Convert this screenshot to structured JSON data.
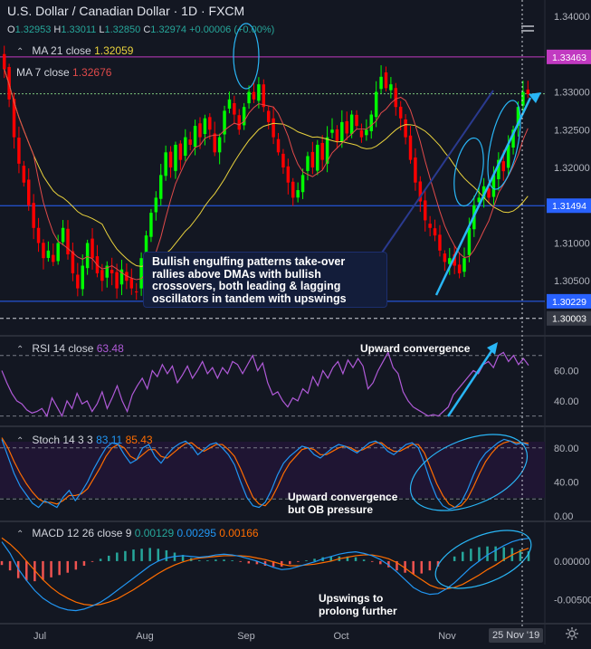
{
  "header": {
    "title": "U.S. Dollar / Canadian Dollar · 1D · FXCM",
    "ohlc": [
      {
        "k": "O",
        "v": "1.32953"
      },
      {
        "k": "H",
        "v": "1.33011"
      },
      {
        "k": "L",
        "v": "1.32850"
      },
      {
        "k": "C",
        "v": "1.32974"
      }
    ],
    "change": "+0.00006 (+0.00%)",
    "ma21_label": "MA 21 close",
    "ma21_value": "1.32059",
    "ma7_label": "MA 7 close",
    "ma7_value": "1.32676"
  },
  "panes": {
    "rsi_label": "RSI 14 close",
    "rsi_value": "63.48",
    "stoch_label": "Stoch 14 3 3",
    "stoch_k": "83.11",
    "stoch_d": "85.43",
    "macd_label": "MACD 12 26 close 9",
    "macd_hist": "0.00129",
    "macd_line": "0.00295",
    "macd_signal": "0.00166"
  },
  "annotations": {
    "callout": "Bullish engulfing patterns take-over rallies above DMAs with bullish crossovers, both leading & lagging oscillators in tandem with upswings",
    "rsi_note": "Upward convergence",
    "stoch_note": "Upward convergence\nbut OB pressure",
    "macd_note": "Upswings to\nprolong further"
  },
  "date_badge": "25 Nov '19",
  "colors": {
    "background": "#131722",
    "bull": "#00ff00",
    "bear": "#ff0000",
    "ma21": "#e9d23d",
    "ma7": "#e04a4a",
    "hline": "#2962ff",
    "resistance": "#c13ac1",
    "trend": "#29b6f6",
    "rsi": "#b05ad8",
    "stoch_k": "#2196f3",
    "stoch_d": "#ff6d00"
  },
  "chart_data": [
    {
      "type": "candlestick",
      "title": "U.S. Dollar / Canadian Dollar · 1D · FXCM",
      "x_ticks": [
        "Jul",
        "Aug",
        "Sep",
        "Oct",
        "Nov"
      ],
      "y_ticks": [
        "1.34000",
        "1.33000",
        "1.32500",
        "1.32000",
        "1.31000",
        "1.30500"
      ],
      "ylim": [
        1.2988,
        1.3412
      ],
      "price_labels": [
        {
          "v": "1.33463",
          "color": "#c13ac1"
        },
        {
          "v": "1.31494",
          "color": "#2962ff"
        },
        {
          "v": "1.30229",
          "color": "#2962ff"
        },
        {
          "v": "1.30003",
          "color": "#363a45"
        }
      ],
      "levels": {
        "resistance": 1.33463,
        "mid": 1.31494,
        "support": 1.30229,
        "current": 1.32974
      },
      "closes": [
        1.333,
        1.329,
        1.324,
        1.3205,
        1.318,
        1.315,
        1.312,
        1.31,
        1.308,
        1.309,
        1.3075,
        1.31,
        1.312,
        1.3085,
        1.306,
        1.304,
        1.307,
        1.31,
        1.308,
        1.306,
        1.305,
        1.307,
        1.306,
        1.304,
        1.3065,
        1.305,
        1.304,
        1.3035,
        1.308,
        1.311,
        1.314,
        1.316,
        1.319,
        1.322,
        1.32,
        1.323,
        1.321,
        1.324,
        1.323,
        1.3255,
        1.324,
        1.3265,
        1.325,
        1.322,
        1.324,
        1.3275,
        1.329,
        1.327,
        1.325,
        1.328,
        1.33,
        1.329,
        1.331,
        1.328,
        1.326,
        1.324,
        1.322,
        1.32,
        1.318,
        1.316,
        1.317,
        1.319,
        1.3215,
        1.32,
        1.323,
        1.321,
        1.324,
        1.325,
        1.3235,
        1.326,
        1.3245,
        1.327,
        1.3255,
        1.324,
        1.325,
        1.327,
        1.33,
        1.332,
        1.3305,
        1.331,
        1.328,
        1.3265,
        1.324,
        1.321,
        1.318,
        1.3155,
        1.313,
        1.312,
        1.311,
        1.309,
        1.3075,
        1.308,
        1.307,
        1.306,
        1.308,
        1.312,
        1.315,
        1.316,
        1.3175,
        1.316,
        1.319,
        1.321,
        1.3195,
        1.323,
        1.325,
        1.328,
        1.33,
        1.3297
      ]
    },
    {
      "type": "line",
      "title": "RSI 14 close",
      "y_ticks": [
        "60.00",
        "40.00"
      ],
      "ylim": [
        25,
        80
      ],
      "series": [
        {
          "name": "RSI 14 close",
          "values": [
            60,
            52,
            45,
            40,
            38,
            34,
            32,
            33,
            35,
            30,
            42,
            36,
            30,
            40,
            35,
            45,
            38,
            40,
            33,
            38,
            46,
            35,
            42,
            50,
            40,
            33,
            44,
            50,
            55,
            48,
            60,
            56,
            64,
            58,
            63,
            52,
            57,
            63,
            55,
            60,
            66,
            58,
            62,
            55,
            62,
            58,
            66,
            64,
            58,
            64,
            70,
            60,
            65,
            52,
            44,
            46,
            40,
            36,
            42,
            40,
            48,
            45,
            56,
            50,
            60,
            55,
            62,
            66,
            58,
            67,
            62,
            68,
            63,
            48,
            52,
            60,
            66,
            72,
            62,
            58,
            46,
            40,
            36,
            34,
            32,
            30,
            31,
            30,
            33,
            36,
            44,
            48,
            52,
            56,
            60,
            58,
            64,
            66,
            62,
            70,
            72,
            66,
            70,
            64,
            68,
            63.5
          ]
        }
      ]
    },
    {
      "type": "line",
      "title": "Stoch 14 3 3",
      "y_ticks": [
        "80.00",
        "40.00",
        "0.00"
      ],
      "ylim": [
        0,
        100
      ],
      "series": [
        {
          "name": "Stoch %K",
          "values": [
            90,
            70,
            50,
            35,
            25,
            15,
            10,
            18,
            14,
            10,
            22,
            30,
            18,
            28,
            40,
            55,
            68,
            80,
            86,
            84,
            72,
            62,
            66,
            80,
            84,
            70,
            62,
            72,
            80,
            85,
            88,
            82,
            72,
            78,
            84,
            86,
            80,
            72,
            60,
            40,
            22,
            12,
            10,
            16,
            30,
            48,
            62,
            70,
            76,
            82,
            80,
            72,
            68,
            74,
            80,
            84,
            82,
            78,
            74,
            80,
            86,
            88,
            84,
            76,
            72,
            78,
            84,
            86,
            80,
            62,
            40,
            22,
            12,
            8,
            10,
            16,
            30,
            48,
            64,
            74,
            80,
            86,
            90,
            88,
            84,
            86,
            83
          ]
        },
        {
          "name": "Stoch %D",
          "values": [
            92,
            80,
            64,
            50,
            38,
            28,
            20,
            16,
            16,
            14,
            18,
            24,
            24,
            26,
            32,
            44,
            56,
            70,
            80,
            84,
            80,
            70,
            66,
            72,
            78,
            78,
            70,
            68,
            74,
            80,
            85,
            86,
            80,
            76,
            80,
            84,
            84,
            78,
            70,
            55,
            38,
            22,
            14,
            12,
            20,
            34,
            50,
            62,
            70,
            78,
            80,
            78,
            72,
            72,
            76,
            80,
            82,
            80,
            76,
            78,
            82,
            86,
            86,
            80,
            76,
            76,
            80,
            84,
            84,
            74,
            56,
            38,
            24,
            14,
            10,
            12,
            20,
            34,
            50,
            64,
            74,
            82,
            86,
            88,
            86,
            86,
            85.4
          ]
        }
      ]
    },
    {
      "type": "line",
      "title": "MACD 12 26 close 9",
      "y_ticks": [
        "0.00000",
        "-0.00500"
      ],
      "ylim": [
        -0.0075,
        0.0035
      ],
      "series": [
        {
          "name": "MACD",
          "values": [
            0.0025,
            0.001,
            -0.001,
            -0.0025,
            -0.0038,
            -0.0048,
            -0.0055,
            -0.006,
            -0.0063,
            -0.0064,
            -0.0062,
            -0.0058,
            -0.0053,
            -0.0046,
            -0.0038,
            -0.003,
            -0.0022,
            -0.0014,
            -0.0006,
            0.0,
            0.0004,
            0.0006,
            0.0007,
            0.0006,
            0.0005,
            0.0006,
            0.0008,
            0.0009,
            0.0008,
            0.0006,
            0.0003,
            0.0,
            -0.0004,
            -0.0008,
            -0.0011,
            -0.001,
            -0.0007,
            -0.0004,
            -0.0001,
            0.0003,
            0.0006,
            0.0009,
            0.0011,
            0.0012,
            0.001,
            0.0007,
            0.0002,
            -0.0005,
            -0.0014,
            -0.0024,
            -0.0034,
            -0.004,
            -0.0043,
            -0.0042,
            -0.0036,
            -0.0028,
            -0.0018,
            -0.0008,
            0.0,
            0.0008,
            0.0014,
            0.002,
            0.0025,
            0.0028,
            0.00295
          ]
        },
        {
          "name": "Signal",
          "values": [
            0.003,
            0.0022,
            0.0012,
            0.0,
            -0.0012,
            -0.0024,
            -0.0034,
            -0.0042,
            -0.0048,
            -0.0053,
            -0.0056,
            -0.0057,
            -0.0056,
            -0.0053,
            -0.0049,
            -0.0043,
            -0.0037,
            -0.003,
            -0.0023,
            -0.0016,
            -0.001,
            -0.0005,
            -0.0001,
            0.0002,
            0.0004,
            0.0005,
            0.0006,
            0.0007,
            0.0007,
            0.0007,
            0.0006,
            0.0004,
            0.0002,
            -0.0001,
            -0.0004,
            -0.0006,
            -0.0006,
            -0.0005,
            -0.0004,
            -0.0002,
            0.0,
            0.0003,
            0.0005,
            0.0007,
            0.0008,
            0.0008,
            0.0006,
            0.0003,
            -0.0002,
            -0.0009,
            -0.0017,
            -0.0024,
            -0.0031,
            -0.0035,
            -0.0036,
            -0.0034,
            -0.003,
            -0.0024,
            -0.0018,
            -0.0011,
            -0.0005,
            0.0002,
            0.0008,
            0.0013,
            0.00166
          ]
        }
      ]
    }
  ]
}
